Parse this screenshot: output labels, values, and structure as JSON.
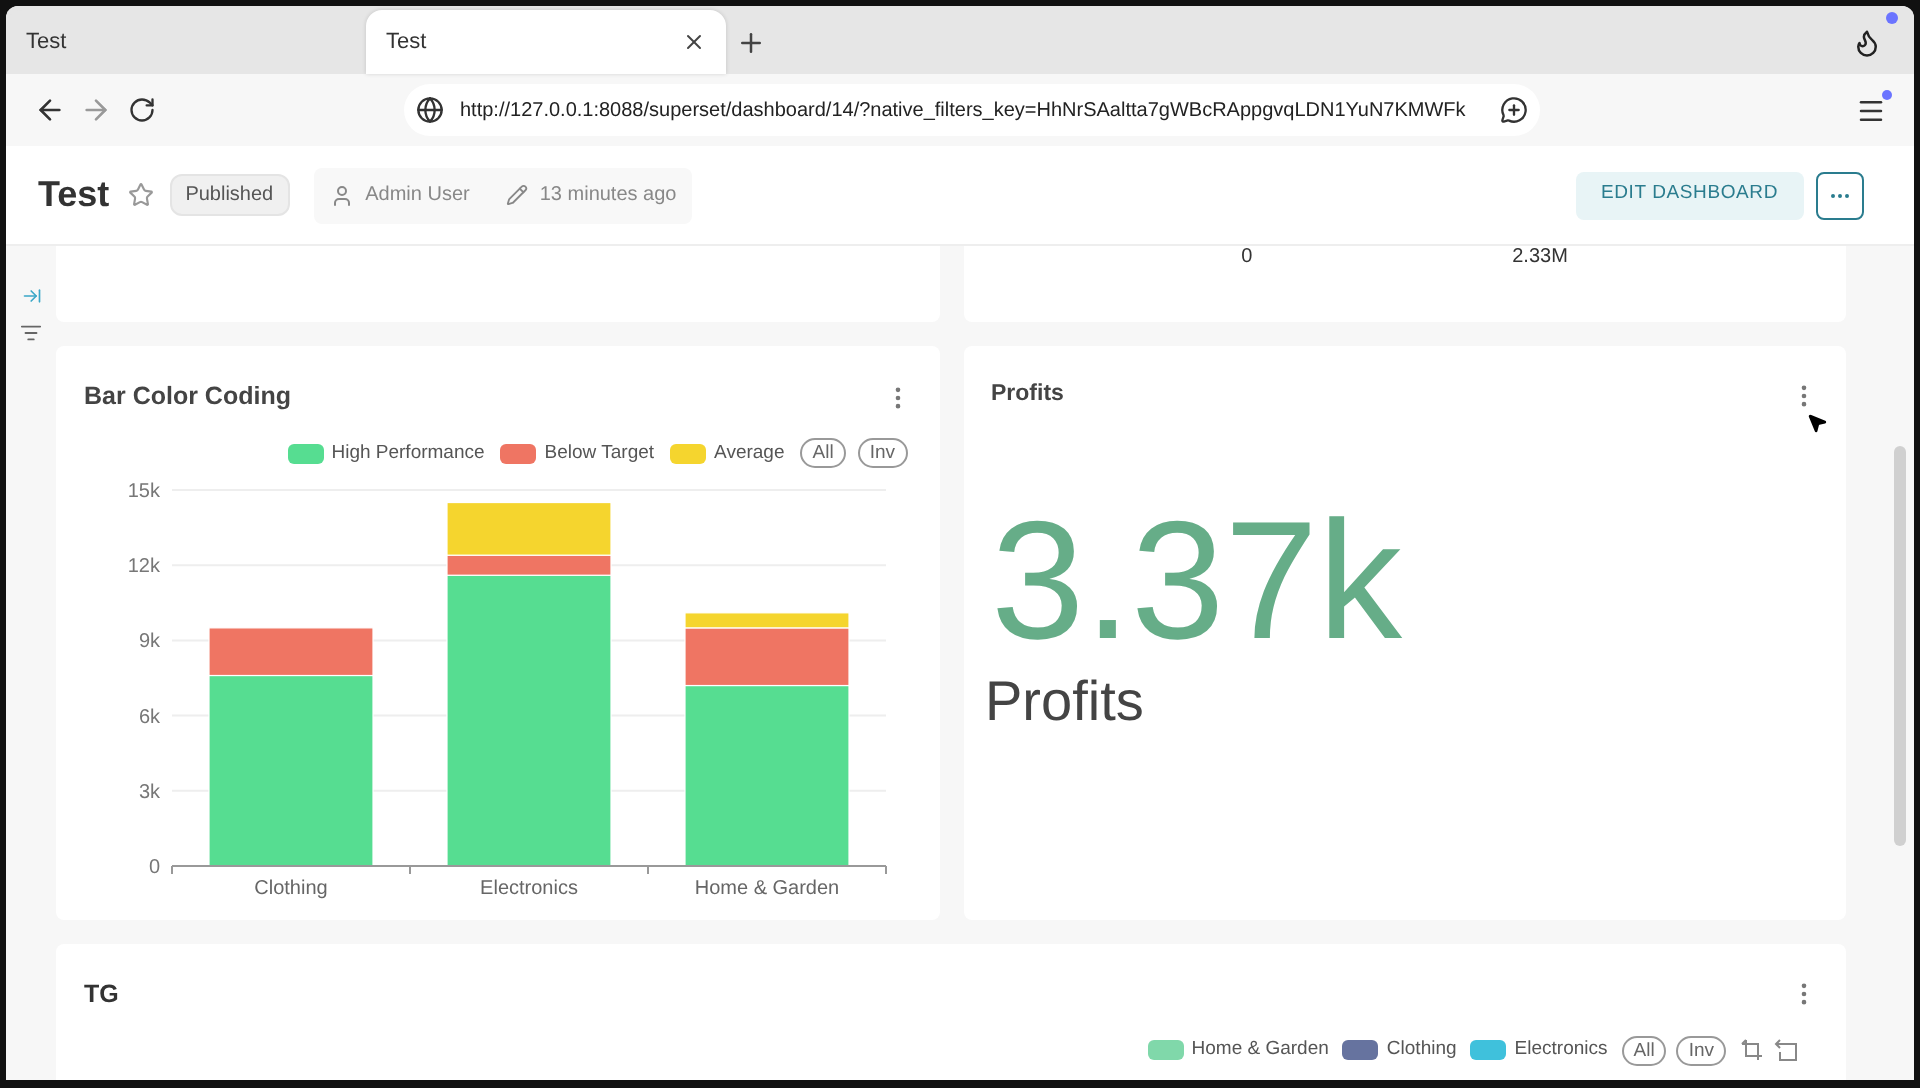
{
  "browser": {
    "tabs": [
      {
        "title": "Test",
        "selected": false
      },
      {
        "title": "Test",
        "selected": true
      }
    ],
    "url": "http://127.0.0.1:8088/superset/dashboard/14/?native_filters_key=HhNrSAaltta7gWBcRAppgvqLDN1YuN7KMWFk"
  },
  "header": {
    "title": "Test",
    "favorite": false,
    "status": "Published",
    "owner": "Admin User",
    "modified": "13 minutes ago",
    "edit_button": "EDIT DASHBOARD"
  },
  "top_right_card": {
    "values": [
      "0",
      "2.33M"
    ]
  },
  "bar_chart": {
    "title": "Bar Color Coding",
    "toggles": [
      "All",
      "Inv"
    ],
    "chart_data": {
      "type": "bar",
      "stacked": true,
      "grid": true,
      "categories": [
        "Clothing",
        "Electronics",
        "Home & Garden"
      ],
      "ylim": [
        0,
        15000
      ],
      "yticks": [
        {
          "value": 0,
          "label": "0"
        },
        {
          "value": 3000,
          "label": "3k"
        },
        {
          "value": 6000,
          "label": "6k"
        },
        {
          "value": 9000,
          "label": "9k"
        },
        {
          "value": 12000,
          "label": "12k"
        },
        {
          "value": 15000,
          "label": "15k"
        }
      ],
      "series": [
        {
          "name": "High Performance",
          "color": "#56dd91",
          "values": [
            7600,
            11600,
            7200
          ]
        },
        {
          "name": "Below Target",
          "color": "#ef7563",
          "values": [
            1900,
            800,
            2300
          ]
        },
        {
          "name": "Average",
          "color": "#f5d52e",
          "values": [
            null,
            2100,
            600
          ]
        }
      ]
    }
  },
  "big_number": {
    "title": "Profits",
    "value": "3.37k",
    "subtitle": "Profits"
  },
  "tg_card": {
    "title": "TG",
    "legend": [
      {
        "label": "Home & Garden",
        "color": "#80d8aa"
      },
      {
        "label": "Clothing",
        "color": "#66739f"
      },
      {
        "label": "Electronics",
        "color": "#3fc1dc"
      }
    ],
    "toggles": [
      "All",
      "Inv"
    ]
  }
}
